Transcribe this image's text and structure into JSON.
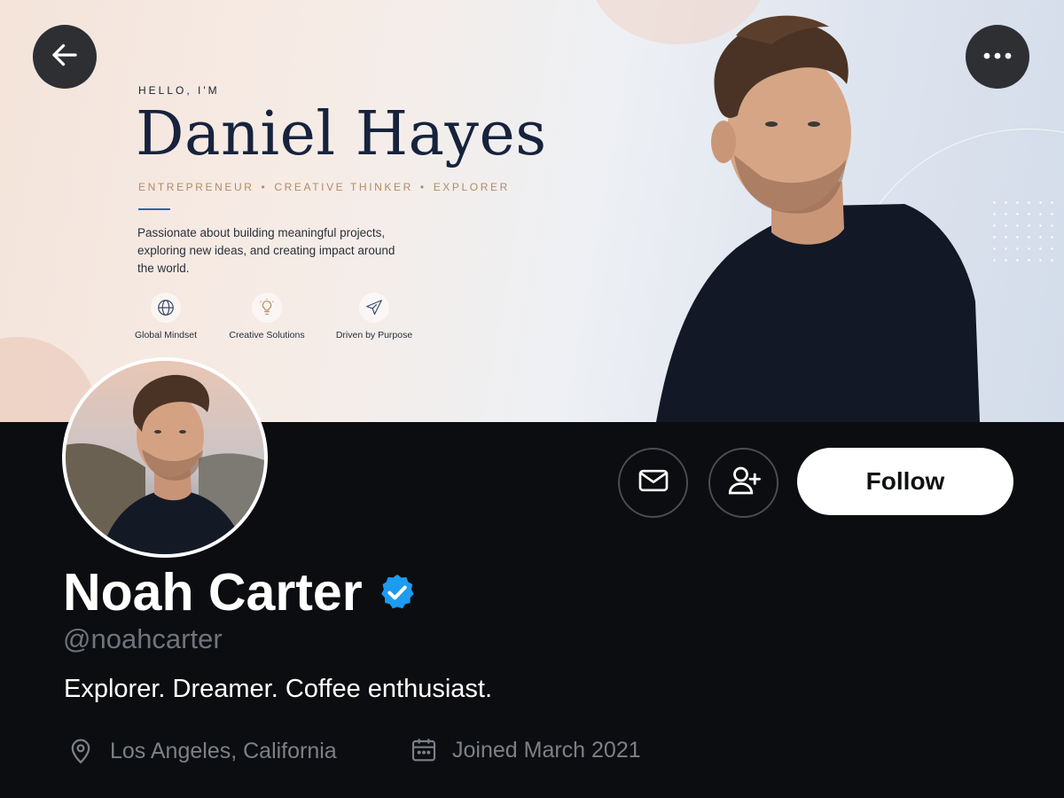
{
  "banner": {
    "greeting": "HELLO, I'M",
    "name": "Daniel Hayes",
    "roles": [
      "ENTREPRENEUR",
      "CREATIVE THINKER",
      "EXPLORER"
    ],
    "role_separator": "•",
    "description": "Passionate about building meaningful projects, exploring new ideas, and creating impact around the world.",
    "features": [
      {
        "icon": "globe-icon",
        "label": "Global Mindset"
      },
      {
        "icon": "lightbulb-icon",
        "label": "Creative Solutions"
      },
      {
        "icon": "paper-plane-icon",
        "label": "Driven by Purpose"
      }
    ]
  },
  "nav": {
    "back_icon": "arrow-left-icon",
    "more_icon": "more-horizontal-icon"
  },
  "actions": {
    "message_icon": "mail-icon",
    "add_friend_icon": "user-plus-icon",
    "follow_label": "Follow"
  },
  "profile": {
    "display_name": "Noah Carter",
    "verified": true,
    "handle": "@noahcarter",
    "bio": "Explorer. Dreamer. Coffee enthusiast.",
    "location": "Los Angeles, California",
    "joined": "Joined March 2021"
  },
  "colors": {
    "background": "#0c0d10",
    "verified_badge": "#1d9bf0",
    "banner_name": "#17233d",
    "roles_text": "#b48a62",
    "accent_line": "#2e63b8",
    "muted_text": "#6f747c",
    "follow_button_bg": "#ffffff"
  }
}
